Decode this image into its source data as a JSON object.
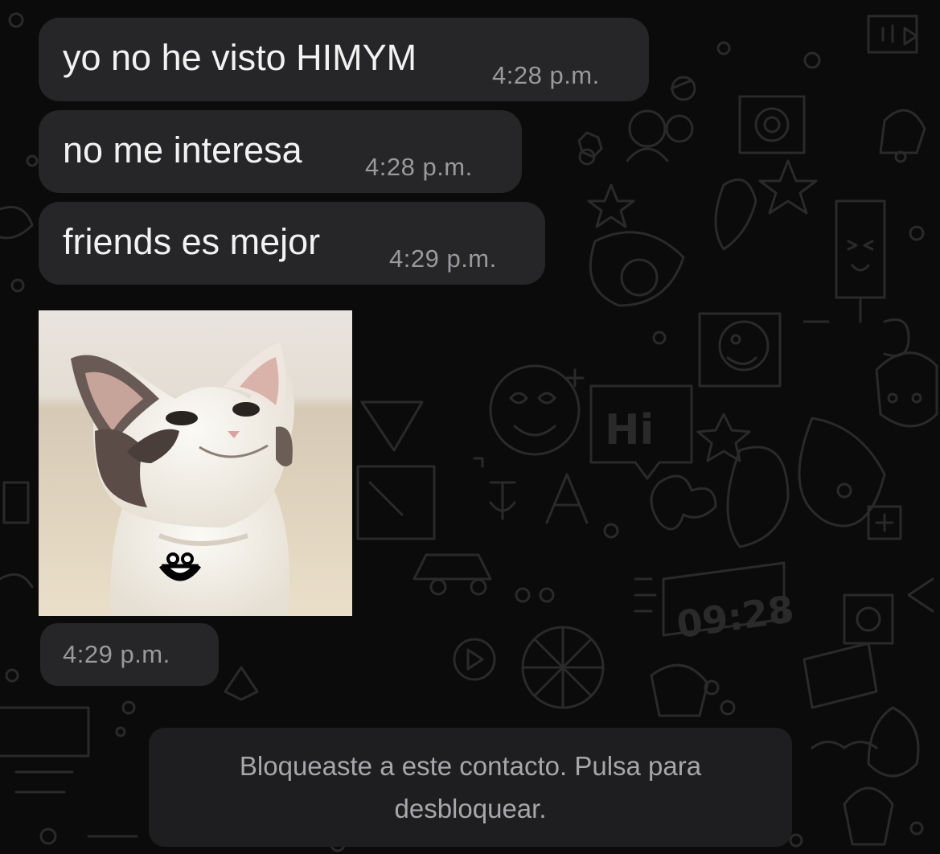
{
  "messages": [
    {
      "text": "yo no he visto HIMYM",
      "time": "4:28 p.m."
    },
    {
      "text": "no me interesa",
      "time": "4:28 p.m."
    },
    {
      "text": "friends es mejor",
      "time": "4:29 p.m."
    }
  ],
  "image_message": {
    "description": "cat photo with smiley emoji",
    "time": "4:29 p.m."
  },
  "blocked_notice": "Bloqueaste a este contacto. Pulsa para desbloquear.",
  "wallpaper_text": {
    "hi": "Hi",
    "clock": "09:28"
  },
  "colors": {
    "background": "#0b0b0b",
    "bubble": "#262628",
    "message_text": "#f2f2f2",
    "time_text": "#9a9a9e"
  }
}
